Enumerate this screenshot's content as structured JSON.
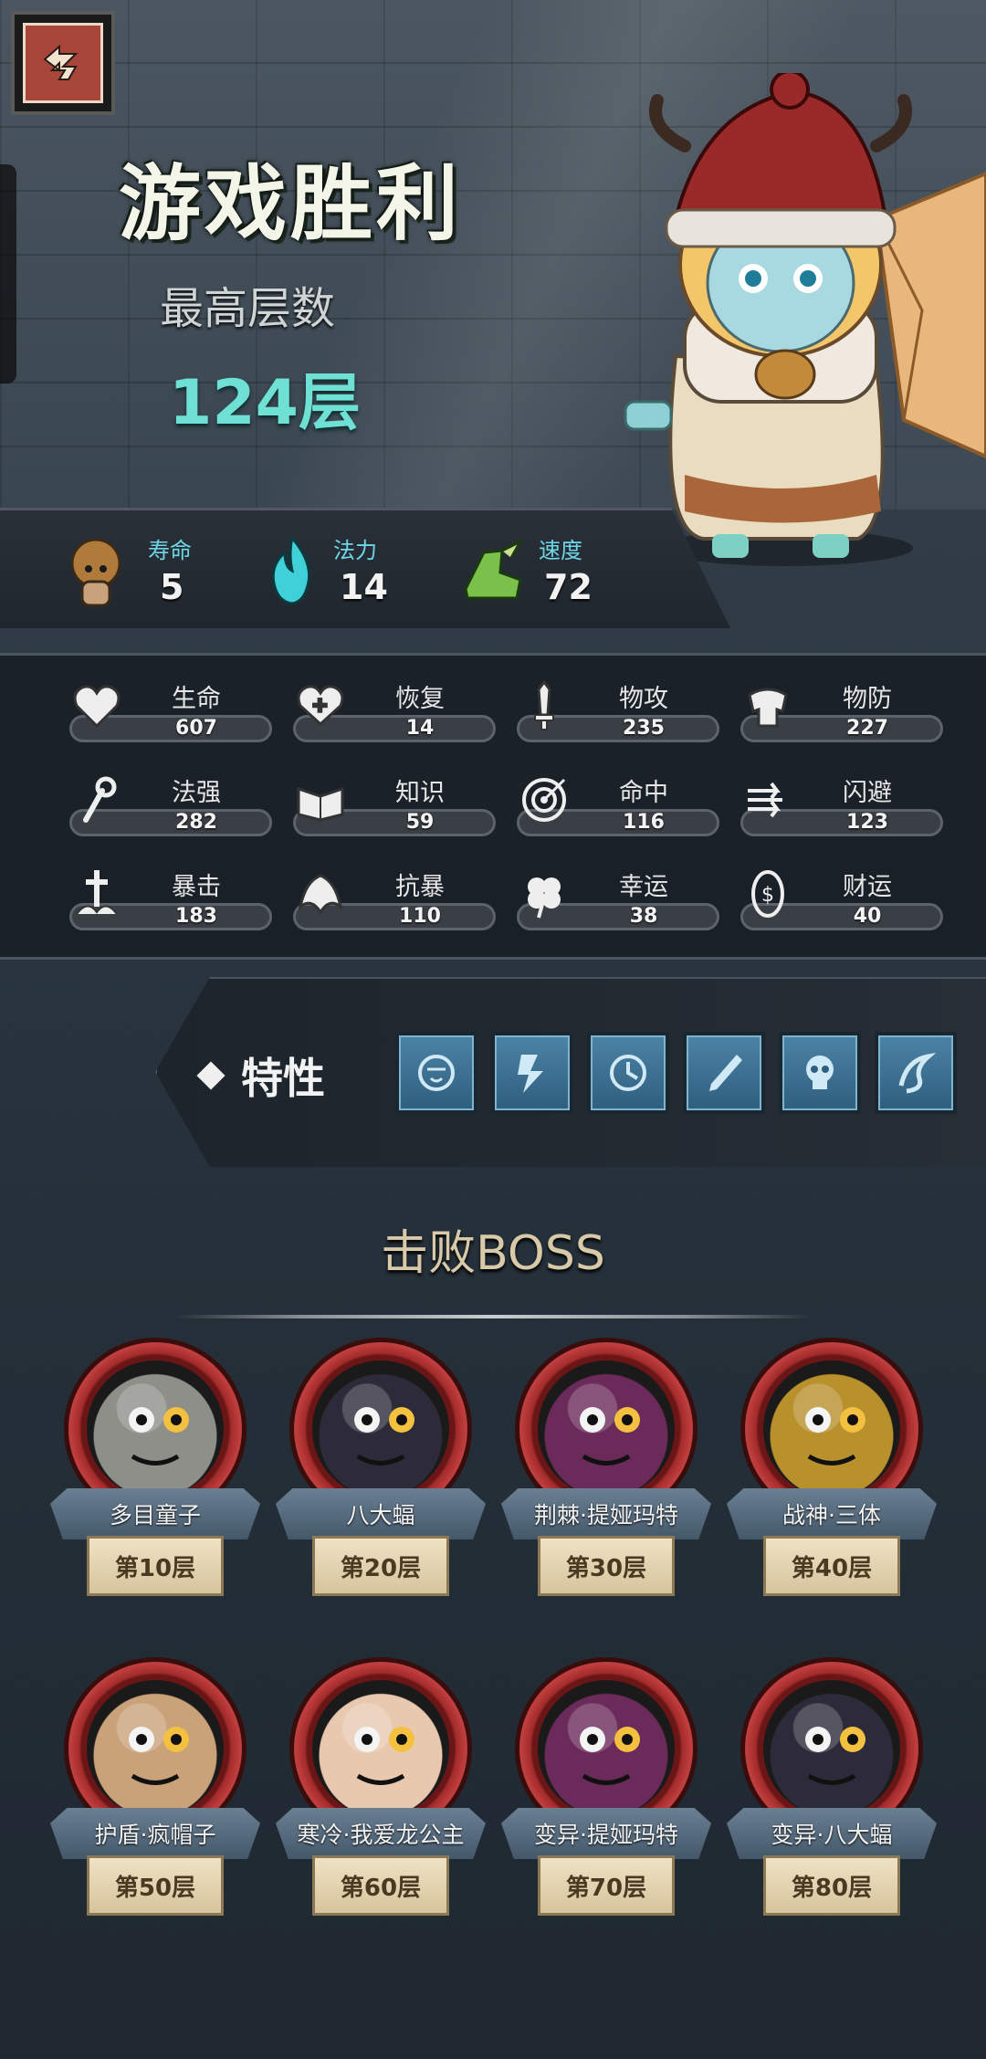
{
  "header": {
    "title": "游戏胜利",
    "max_floor_label": "最高层数",
    "max_floor_value": "124层"
  },
  "top_stats": [
    {
      "label": "寿命",
      "value": "5",
      "icon": "lifespan-head-icon"
    },
    {
      "label": "法力",
      "value": "14",
      "icon": "mana-flame-icon"
    },
    {
      "label": "速度",
      "value": "72",
      "icon": "speed-boot-icon"
    }
  ],
  "stats": [
    {
      "name": "生命",
      "value": "607",
      "icon": "heart-icon"
    },
    {
      "name": "恢复",
      "value": "14",
      "icon": "heal-heart-icon"
    },
    {
      "name": "物攻",
      "value": "235",
      "icon": "sword-icon"
    },
    {
      "name": "物防",
      "value": "227",
      "icon": "armor-icon"
    },
    {
      "name": "法强",
      "value": "282",
      "icon": "magic-staff-icon"
    },
    {
      "name": "知识",
      "value": "59",
      "icon": "book-icon"
    },
    {
      "name": "命中",
      "value": "116",
      "icon": "target-icon"
    },
    {
      "name": "闪避",
      "value": "123",
      "icon": "dodge-arrows-icon"
    },
    {
      "name": "暴击",
      "value": "183",
      "icon": "crit-sword-icon"
    },
    {
      "name": "抗暴",
      "value": "110",
      "icon": "crit-resist-icon"
    },
    {
      "name": "幸运",
      "value": "38",
      "icon": "clover-icon"
    },
    {
      "name": "财运",
      "value": "40",
      "icon": "coin-icon"
    }
  ],
  "traits": {
    "label": "特性",
    "icons": [
      "mask-trait-icon",
      "lightning-trait-icon",
      "clock-trait-icon",
      "dagger-trait-icon",
      "skull-trait-icon",
      "wave-trait-icon"
    ]
  },
  "bosses_section": {
    "title": "击败BOSS",
    "bosses": [
      {
        "name": "多目童子",
        "floor": "第10层",
        "color": "#8f8f8a"
      },
      {
        "name": "八大蝠",
        "floor": "第20层",
        "color": "#2d2a3a"
      },
      {
        "name": "荆棘·提娅玛特",
        "floor": "第30层",
        "color": "#6a2a5a"
      },
      {
        "name": "战神·三体",
        "floor": "第40层",
        "color": "#b8902c"
      },
      {
        "name": "护盾·疯帽子",
        "floor": "第50层",
        "color": "#c9a27a"
      },
      {
        "name": "寒冷·我爱龙公主",
        "floor": "第60层",
        "color": "#e8c9b0"
      },
      {
        "name": "变异·提娅玛特",
        "floor": "第70层",
        "color": "#6a2a5a"
      },
      {
        "name": "变异·八大蝠",
        "floor": "第80层",
        "color": "#2d2a3a"
      }
    ]
  }
}
